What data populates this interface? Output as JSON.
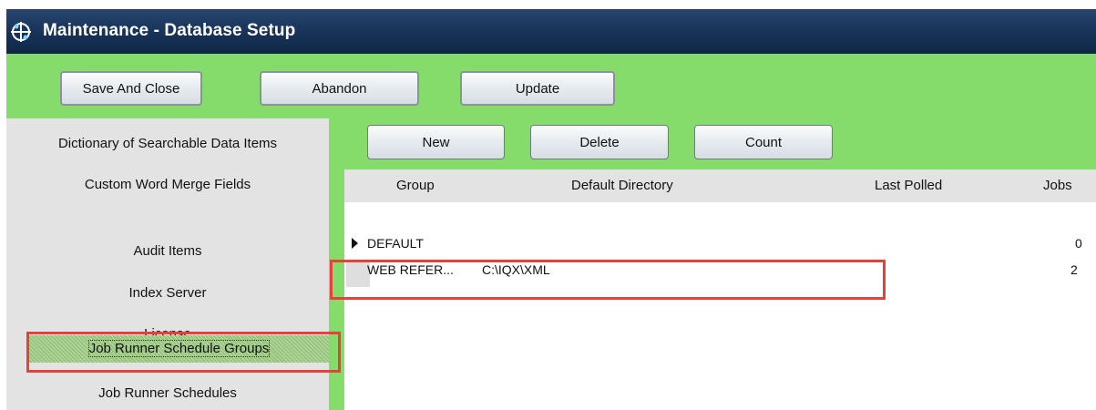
{
  "window": {
    "title": "Maintenance - Database Setup",
    "icon": "app-network-icon"
  },
  "toolbar": {
    "save_and_close": "Save And Close",
    "abandon": "Abandon",
    "update": "Update"
  },
  "sidebar": {
    "items": [
      {
        "label": "Dictionary of Searchable Data Items",
        "selected": false
      },
      {
        "label": "Custom Word Merge Fields",
        "selected": false
      },
      {
        "label": "Audit Items",
        "selected": false
      },
      {
        "label": "Index Server",
        "selected": false
      },
      {
        "label": "License",
        "selected": false
      },
      {
        "label": "Job Runner Schedule Groups",
        "selected": true
      },
      {
        "label": "Job Runner Schedules",
        "selected": false
      }
    ]
  },
  "actions": {
    "new": "New",
    "delete": "Delete",
    "count": "Count"
  },
  "grid": {
    "columns": [
      "Group",
      "Default Directory",
      "Last Polled",
      "Jobs"
    ],
    "rows": [
      {
        "group": "DEFAULT",
        "directory": "",
        "last_polled": "",
        "jobs": "0",
        "current": true
      },
      {
        "group": "WEB REFER...",
        "directory": "C:\\IQX\\XML",
        "last_polled": "",
        "jobs": "2",
        "current": false
      }
    ]
  },
  "colors": {
    "accent_green": "#86dc6a",
    "title_bar": "#173257",
    "highlight_red": "#e8413c"
  }
}
